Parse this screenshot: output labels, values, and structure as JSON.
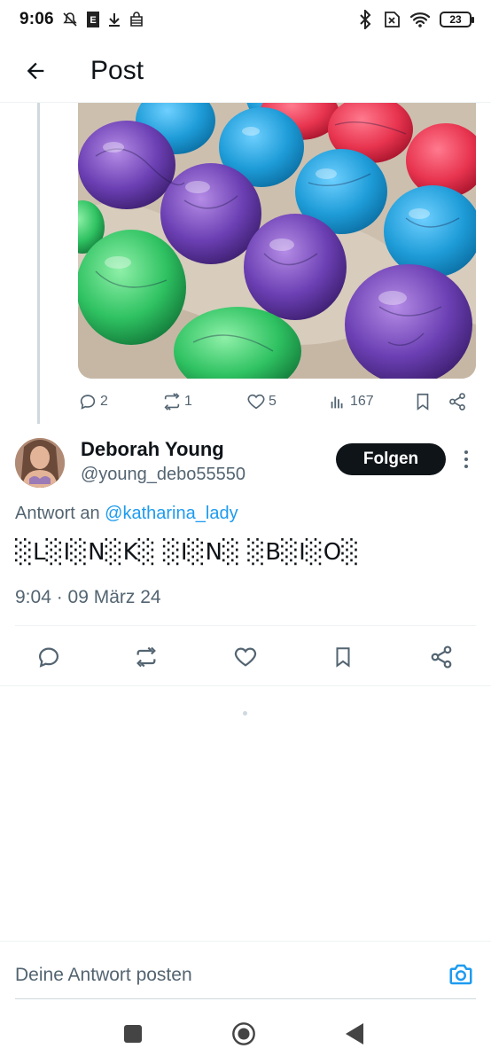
{
  "status_bar": {
    "time": "9:06",
    "battery": "23",
    "icons": [
      "mute-icon",
      "notification-e-icon",
      "download-icon",
      "bag-icon",
      "bluetooth-icon",
      "no-sim-icon",
      "wifi-icon",
      "battery-icon"
    ]
  },
  "header": {
    "title": "Post",
    "back_icon": "arrow-left-icon"
  },
  "parent_post": {
    "media_description": "",
    "stats": {
      "replies": "2",
      "reposts": "1",
      "likes": "5",
      "views": "167"
    }
  },
  "reply": {
    "display_name": "Deborah Young",
    "handle": "@young_debo55550",
    "follow_label": "Folgen",
    "replying_prefix": "Antwort an ",
    "replying_to": "@katharina_lady",
    "text": "░L░I░N░K░ ░I░N░ ░B░I░O░",
    "timestamp": "9:04 · 09 März 24"
  },
  "composer": {
    "placeholder": "Deine Antwort posten"
  },
  "colors": {
    "accent": "#1d9bf0",
    "text_primary": "#0f1419",
    "text_secondary": "#536471",
    "divider": "#eff3f4"
  }
}
